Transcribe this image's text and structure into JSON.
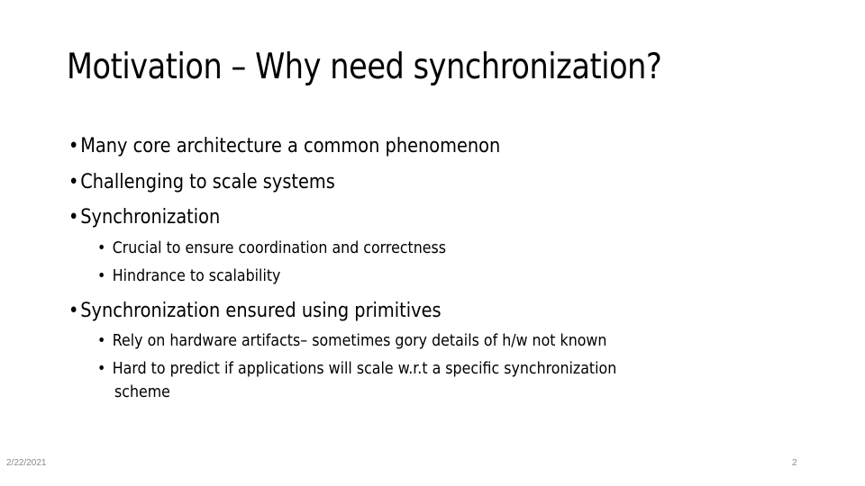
{
  "slide": {
    "title": "Motivation – Why need synchronization?",
    "bullets": [
      {
        "text": "Many core architecture a common phenomenon"
      },
      {
        "text": "Challenging to scale systems"
      },
      {
        "text": "Synchronization",
        "sub": [
          "Crucial to ensure coordination and correctness",
          "Hindrance to scalability"
        ]
      },
      {
        "text": "Synchronization ensured using primitives",
        "sub": [
          "Rely on hardware artifacts– sometimes gory details of h/w not known",
          "Hard to predict if applications will scale w.r.t a specific synchronization",
          "scheme"
        ]
      }
    ],
    "bullet_glyph": "•"
  },
  "footer": {
    "date": "2/22/2021",
    "page_number": "2"
  }
}
